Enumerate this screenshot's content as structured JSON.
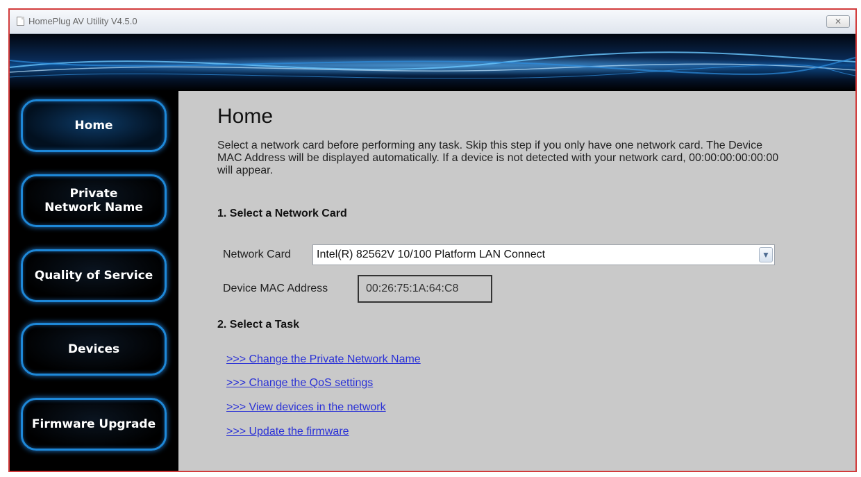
{
  "window": {
    "title": "HomePlug AV Utility V4.5.0",
    "close_label": "✕"
  },
  "sidebar": {
    "items": [
      {
        "label": "Home",
        "active": true
      },
      {
        "label": "Private\nNetwork Name",
        "active": false
      },
      {
        "label": "Quality of Service",
        "active": false
      },
      {
        "label": "Devices",
        "active": false
      },
      {
        "label": "Firmware Upgrade",
        "active": false
      }
    ]
  },
  "main": {
    "title": "Home",
    "intro": "Select a network card before performing any task. Skip this step if you only have one network card. The Device MAC Address will be displayed automatically. If a device is not detected with your network card, 00:00:00:00:00:00 will appear.",
    "section1_heading": "1. Select a Network Card",
    "network_card_label": "Network Card",
    "network_card_value": "Intel(R) 82562V 10/100 Platform LAN Connect",
    "mac_label": "Device MAC Address",
    "mac_value": "00:26:75:1A:64:C8",
    "section2_heading": "2. Select a Task",
    "tasks": [
      ">>> Change the Private Network Name",
      ">>> Change the QoS settings",
      ">>> View devices in the network",
      ">>> Update the firmware"
    ]
  },
  "colors": {
    "nav_glow": "#1e88d8",
    "link": "#2a31d6",
    "content_bg": "#c9c9c9",
    "frame_border": "#d23b3b"
  }
}
